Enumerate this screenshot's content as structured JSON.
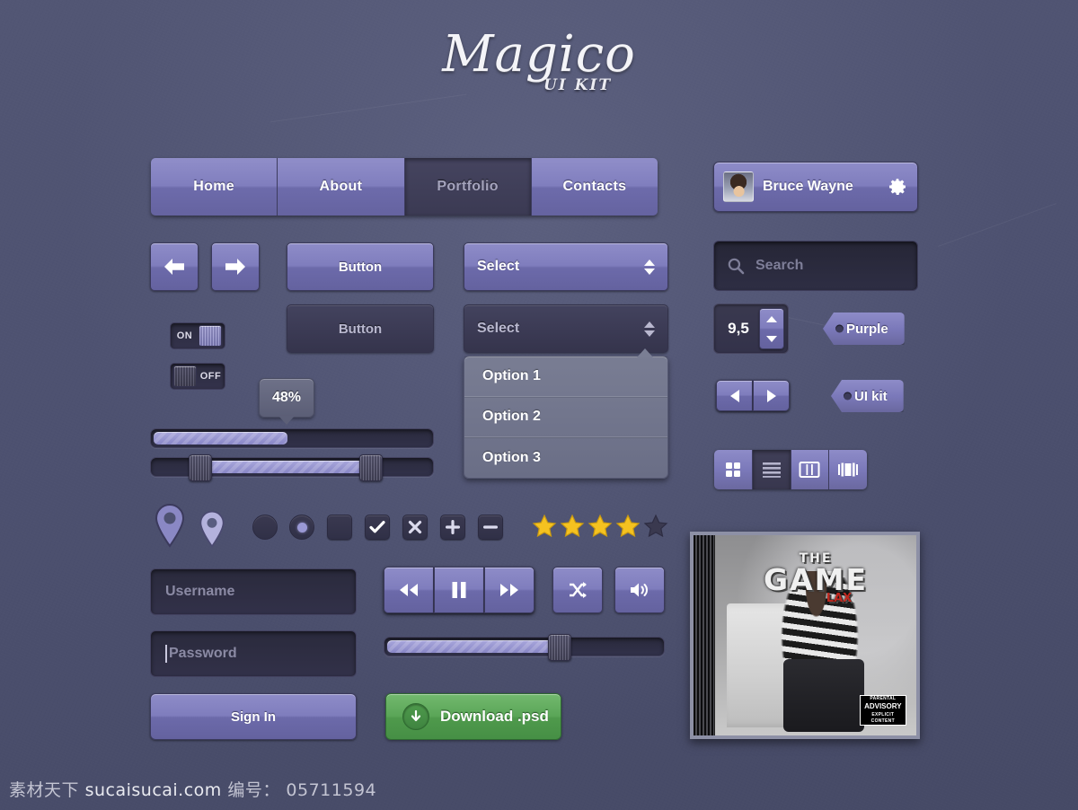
{
  "logo": {
    "title": "Magico",
    "subtitle": "UI KIT"
  },
  "nav": {
    "tabs": [
      {
        "label": "Home",
        "active": false
      },
      {
        "label": "About",
        "active": false
      },
      {
        "label": "Portfolio",
        "active": true
      },
      {
        "label": "Contacts",
        "active": false
      }
    ]
  },
  "user": {
    "name": "Bruce Wayne",
    "avatar_icon": "user-photo",
    "settings_icon": "gear-icon"
  },
  "buttons": {
    "back_icon": "arrow-left-icon",
    "forward_icon": "arrow-right-icon",
    "primary_label": "Button",
    "secondary_label": "Button"
  },
  "selects": {
    "primary_label": "Select",
    "secondary_label": "Select",
    "options": [
      "Option 1",
      "Option 2",
      "Option 3"
    ]
  },
  "toggles": [
    {
      "label": "ON",
      "state": "on"
    },
    {
      "label": "OFF",
      "state": "off"
    }
  ],
  "progress": {
    "tooltip": "48%",
    "value": 48
  },
  "range": {
    "min_handle": 15,
    "max_handle": 74
  },
  "search": {
    "placeholder": "Search",
    "icon": "search-icon"
  },
  "stepper": {
    "value": "9,5",
    "up_icon": "triangle-up-icon",
    "down_icon": "triangle-down-icon"
  },
  "pager": {
    "prev_icon": "triangle-left-icon",
    "next_icon": "triangle-right-icon"
  },
  "tags": [
    {
      "label": "Purple"
    },
    {
      "label": "UI kit"
    }
  ],
  "view_switcher": {
    "items": [
      {
        "icon": "grid-view-icon",
        "active": false
      },
      {
        "icon": "list-view-icon",
        "active": true
      },
      {
        "icon": "column-view-icon",
        "active": false
      },
      {
        "icon": "coverflow-view-icon",
        "active": false
      }
    ]
  },
  "markers": [
    {
      "icon": "map-pin-icon",
      "variant": "dark"
    },
    {
      "icon": "map-pin-icon",
      "variant": "light"
    }
  ],
  "controls": [
    {
      "icon": "radio-unchecked-icon"
    },
    {
      "icon": "radio-checked-icon"
    },
    {
      "icon": "checkbox-unchecked-icon"
    },
    {
      "icon": "checkbox-checked-icon"
    },
    {
      "icon": "close-x-icon"
    },
    {
      "icon": "plus-icon"
    },
    {
      "icon": "minus-icon"
    }
  ],
  "rating": {
    "value": 4,
    "max": 5,
    "filled_color": "#f5c220",
    "empty_color": "#3a394f"
  },
  "login": {
    "username_placeholder": "Username",
    "password_placeholder": "Password",
    "submit_label": "Sign In"
  },
  "download": {
    "label": "Download .psd",
    "icon": "download-arrow-icon",
    "color": "#55a052"
  },
  "player": {
    "rewind_icon": "rewind-icon",
    "pause_icon": "pause-icon",
    "forward_icon": "fast-forward-icon",
    "shuffle_icon": "shuffle-icon",
    "volume_icon": "volume-icon",
    "seek_value": 60
  },
  "album": {
    "artist": "THE",
    "title": "GAME",
    "edition": "LAX",
    "advisory_top": "PARENTAL",
    "advisory_main": "ADVISORY",
    "advisory_bottom": "EXPLICIT CONTENT"
  },
  "footer": {
    "site_cn": "素材天下",
    "site": "sucaisucai.com",
    "id_label": "编号：",
    "id": "05711594"
  },
  "theme": {
    "background": "#4e5272",
    "accent": "#807ebe",
    "dark": "#3b3a53",
    "green": "#55a052",
    "star": "#f5c220"
  }
}
